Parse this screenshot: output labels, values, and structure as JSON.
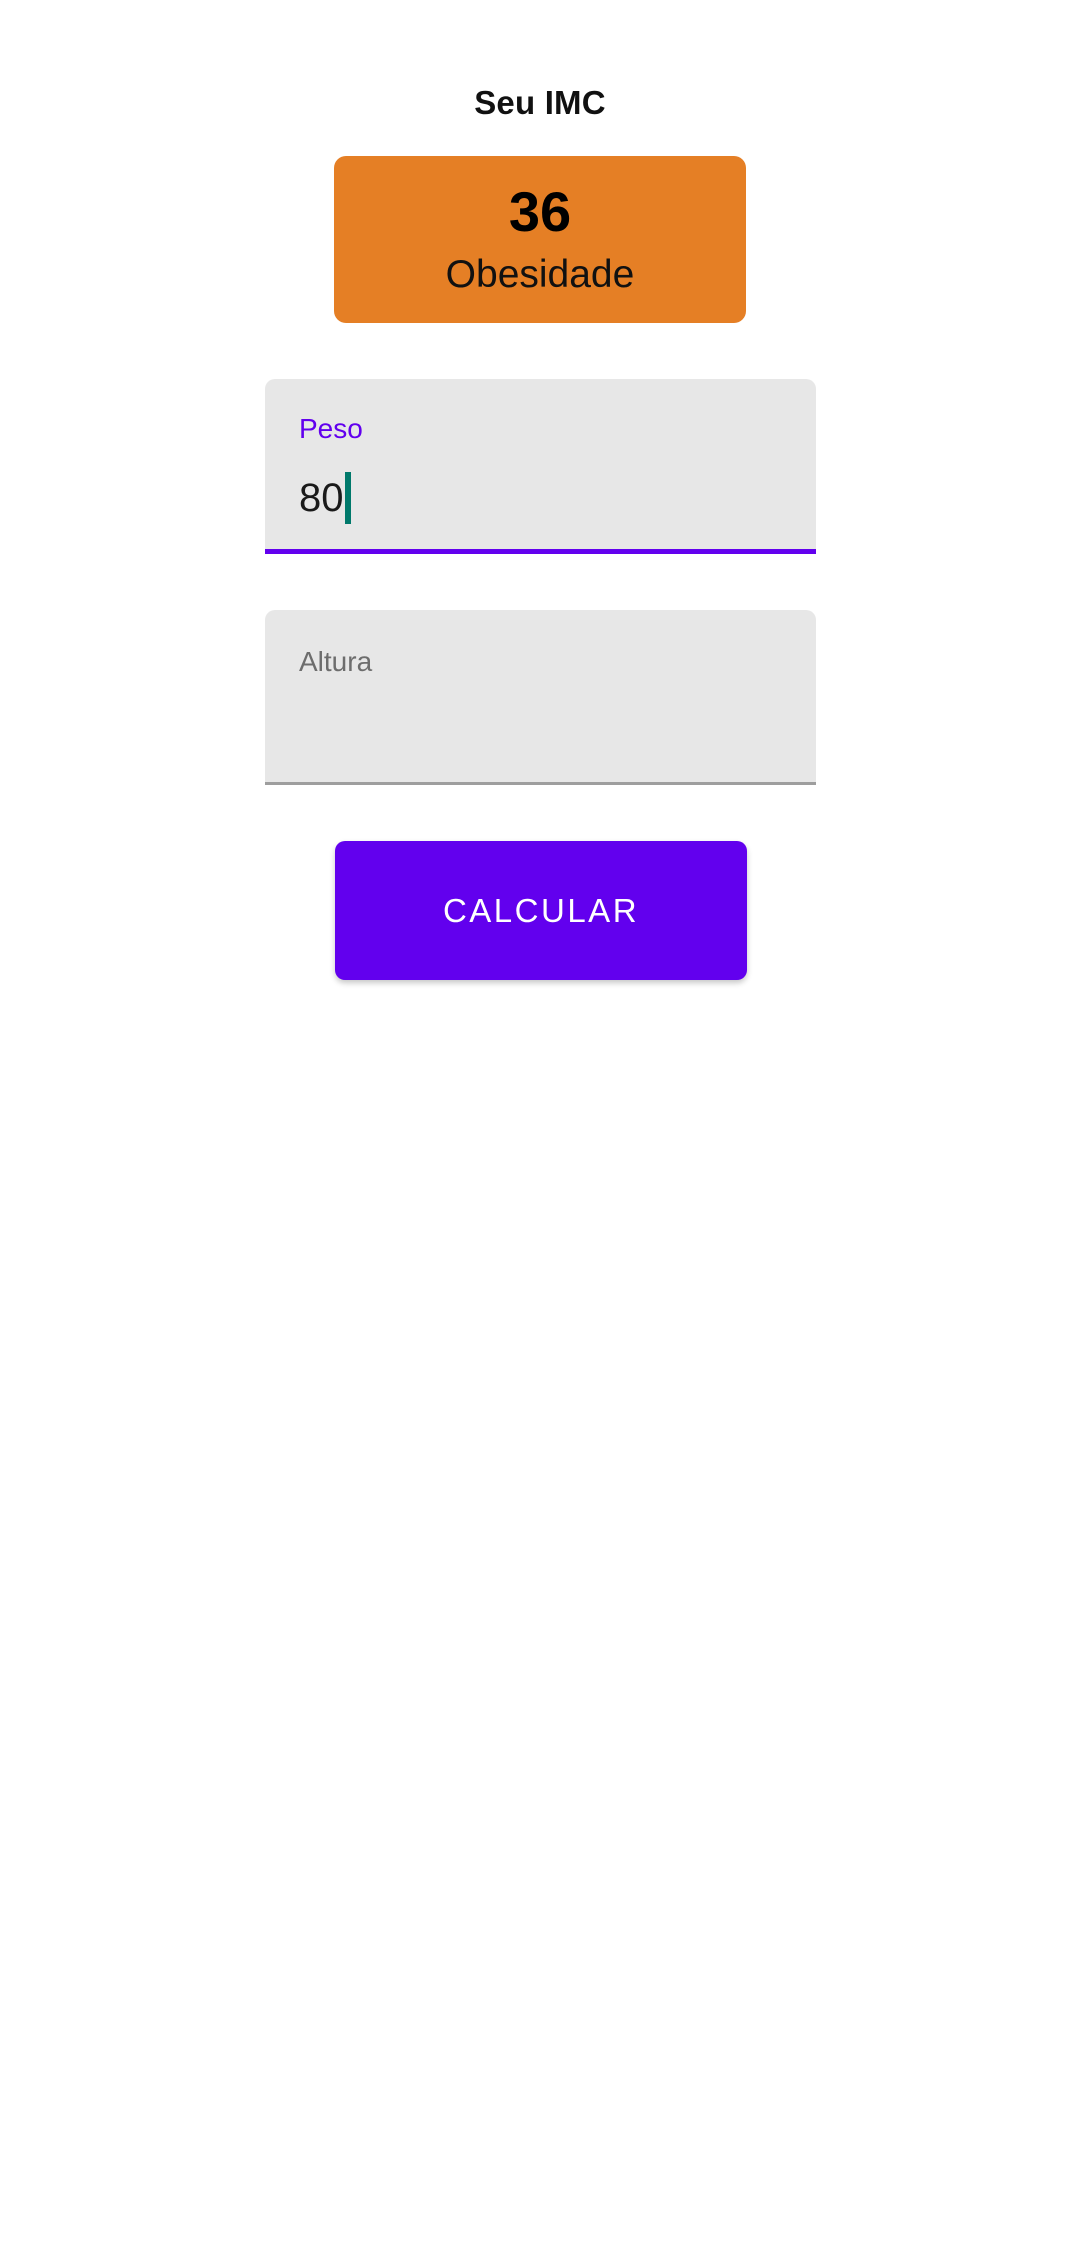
{
  "header": {
    "title": "Seu IMC"
  },
  "result": {
    "value": "36",
    "category": "Obesidade"
  },
  "form": {
    "weight": {
      "label": "Peso",
      "value": "80"
    },
    "height": {
      "label": "Altura",
      "value": ""
    },
    "submit_label": "CALCULAR"
  },
  "colors": {
    "result_card": "#e57f25",
    "primary": "#6200ee",
    "cursor": "#00796b"
  }
}
